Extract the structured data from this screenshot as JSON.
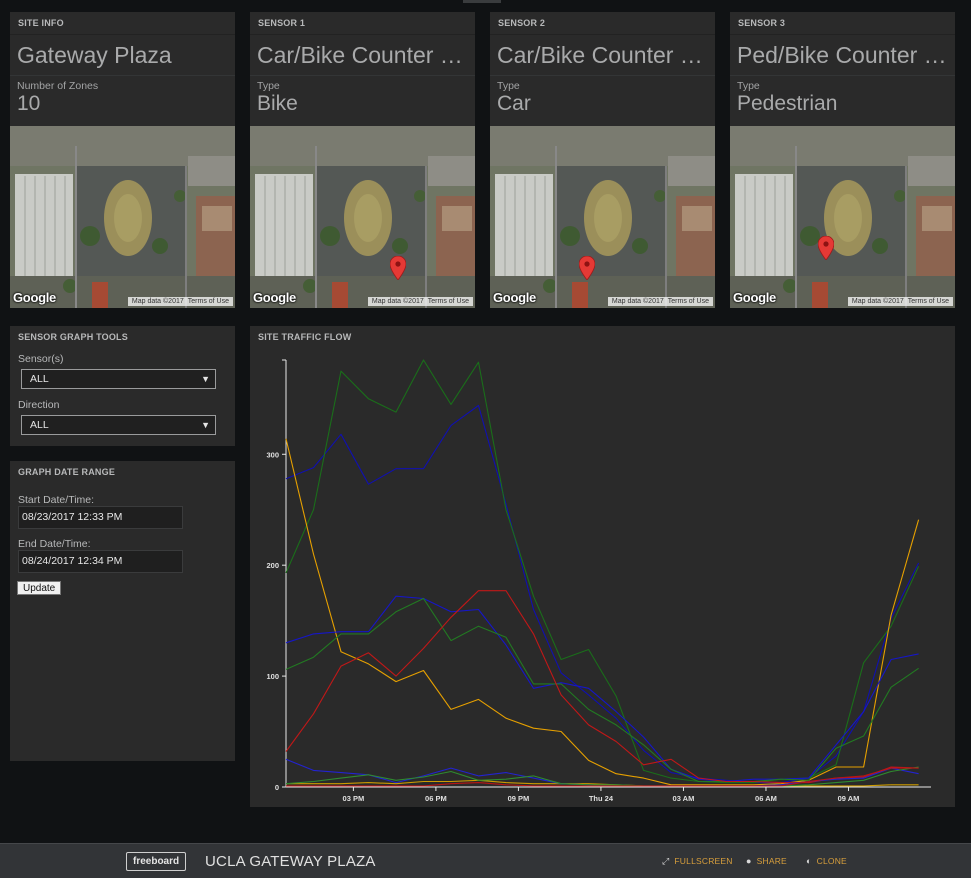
{
  "site_info": {
    "pane_title": "SITE INFO",
    "name": "Gateway Plaza",
    "field_label": "Number of Zones",
    "field_value": "10"
  },
  "sensors": [
    {
      "pane_title": "SENSOR 1",
      "name": "Car/Bike Counter …",
      "field_label": "Type",
      "field_value": "Bike"
    },
    {
      "pane_title": "SENSOR 2",
      "name": "Car/Bike Counter …",
      "field_label": "Type",
      "field_value": "Car"
    },
    {
      "pane_title": "SENSOR 3",
      "name": "Ped/Bike Counter …",
      "field_label": "Type",
      "field_value": "Pedestrian"
    }
  ],
  "map": {
    "logo": "Google",
    "map_data": "Map data ©2017",
    "terms": "Terms of Use"
  },
  "graph_tools": {
    "pane_title": "SENSOR GRAPH TOOLS",
    "sensor_label": "Sensor(s)",
    "sensor_value": "ALL",
    "direction_label": "Direction",
    "direction_value": "ALL"
  },
  "date_range": {
    "pane_title": "GRAPH DATE RANGE",
    "start_label": "Start Date/Time:",
    "start_value": "08/23/2017 12:33 PM",
    "end_label": "End Date/Time:",
    "end_value": "08/24/2017 12:34 PM",
    "update_label": "Update"
  },
  "traffic_pane_title": "SITE TRAFFIC FLOW",
  "footer": {
    "logo": "freeboard",
    "title": "UCLA GATEWAY PLAZA",
    "fullscreen": "FULLSCREEN",
    "share": "SHARE",
    "clone": "CLONE"
  },
  "chart_data": {
    "type": "line",
    "x_tick_labels": [
      "03 PM",
      "06 PM",
      "09 PM",
      "Thu 24",
      "03 AM",
      "06 AM",
      "09 AM"
    ],
    "x_tick_hours": [
      15,
      18,
      21,
      24,
      27,
      30,
      33
    ],
    "x_range": [
      12.55,
      36.0
    ],
    "y_range": [
      0,
      385
    ],
    "y_ticks": [
      0,
      100,
      200,
      300
    ],
    "x_hours": [
      12.55,
      13.55,
      14.55,
      15.55,
      16.55,
      17.55,
      18.55,
      19.55,
      20.55,
      21.55,
      22.55,
      23.55,
      24.55,
      25.55,
      26.55,
      27.55,
      28.55,
      29.55,
      30.55,
      31.55,
      32.55,
      33.55,
      34.55,
      35.55
    ],
    "series": [
      {
        "color": "#1010b0",
        "values": [
          278,
          288,
          318,
          273,
          287,
          287,
          326,
          344,
          255,
          160,
          103,
          83,
          62,
          33,
          13,
          8,
          6,
          4,
          4,
          8,
          28,
          68,
          152,
          202
        ]
      },
      {
        "color": "#1a6e1a",
        "values": [
          193,
          250,
          375,
          350,
          338,
          385,
          345,
          383,
          250,
          172,
          115,
          124,
          82,
          15,
          8,
          5,
          4,
          4,
          7,
          8,
          20,
          112,
          145,
          199
        ]
      },
      {
        "color": "#e6a000",
        "values": [
          314,
          210,
          122,
          111,
          95,
          105,
          70,
          79,
          62,
          53,
          50,
          24,
          12,
          8,
          2,
          2,
          2,
          2,
          3,
          6,
          18,
          18,
          155,
          241
        ]
      },
      {
        "color": "#1616c8",
        "values": [
          130,
          138,
          140,
          140,
          172,
          170,
          158,
          160,
          128,
          89,
          94,
          89,
          68,
          45,
          16,
          7,
          5,
          7,
          7,
          8,
          38,
          68,
          115,
          120
        ]
      },
      {
        "color": "#227a22",
        "values": [
          106,
          117,
          138,
          138,
          158,
          170,
          132,
          145,
          135,
          93,
          93,
          70,
          56,
          38,
          16,
          5,
          5,
          5,
          7,
          6,
          35,
          46,
          90,
          107
        ]
      },
      {
        "color": "#c01818",
        "values": [
          32,
          66,
          109,
          121,
          100,
          125,
          153,
          177,
          177,
          138,
          83,
          56,
          41,
          20,
          25,
          8,
          5,
          5,
          4,
          4,
          8,
          9,
          18,
          17
        ]
      },
      {
        "color": "#cc9a00",
        "values": [
          3,
          3,
          3,
          4,
          3,
          5,
          5,
          6,
          4,
          3,
          3,
          3,
          2,
          1,
          1,
          1,
          1,
          1,
          1,
          1,
          1,
          1,
          2,
          2
        ]
      },
      {
        "color": "#2323d0",
        "values": [
          25,
          15,
          13,
          11,
          4,
          10,
          17,
          10,
          13,
          8,
          3,
          2,
          1,
          1,
          1,
          1,
          1,
          1,
          2,
          5,
          7,
          8,
          17,
          12
        ]
      },
      {
        "color": "#2f8a2f",
        "values": [
          3,
          5,
          8,
          11,
          6,
          9,
          14,
          6,
          7,
          10,
          3,
          2,
          2,
          1,
          1,
          1,
          1,
          1,
          1,
          2,
          4,
          6,
          14,
          18
        ]
      },
      {
        "color": "#b81515",
        "values": [
          1,
          1,
          1,
          1,
          1,
          1,
          3,
          4,
          2,
          1,
          1,
          1,
          1,
          1,
          1,
          1,
          1,
          1,
          1,
          5,
          8,
          10,
          17,
          17
        ]
      },
      {
        "color": "#f0f0f0",
        "values": [
          0,
          0,
          0,
          0,
          0,
          0,
          0,
          0,
          0,
          0,
          0,
          0,
          0,
          0,
          0,
          0,
          0,
          0,
          0,
          0,
          0,
          0,
          0,
          0
        ]
      }
    ]
  }
}
